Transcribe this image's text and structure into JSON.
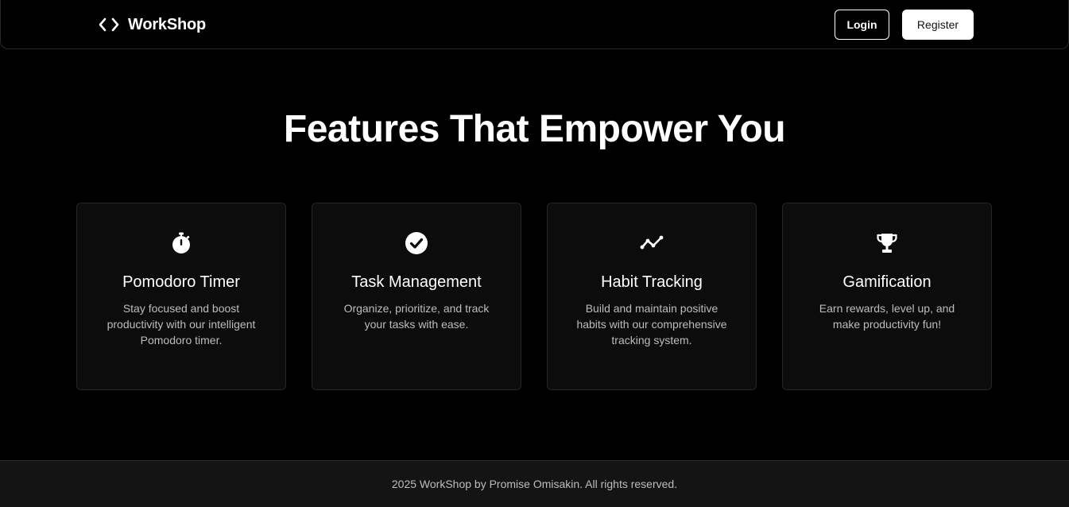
{
  "navbar": {
    "brand_name": "WorkShop",
    "brand_icon": "code-brackets-icon",
    "login_label": "Login",
    "register_label": "Register"
  },
  "hero": {
    "heading": "Features That Empower You"
  },
  "features": [
    {
      "icon": "stopwatch-icon",
      "title": "Pomodoro Timer",
      "description": "Stay focused and boost productivity with our intelligent Pomodoro timer."
    },
    {
      "icon": "check-circle-icon",
      "title": "Task Management",
      "description": "Organize, prioritize, and track your tasks with ease."
    },
    {
      "icon": "trend-line-icon",
      "title": "Habit Tracking",
      "description": "Build and maintain positive habits with our comprehensive tracking system."
    },
    {
      "icon": "trophy-icon",
      "title": "Gamification",
      "description": "Earn rewards, level up, and make productivity fun!"
    }
  ],
  "footer": {
    "text": "2025 WorkShop by Promise Omisakin. All rights reserved."
  },
  "colors": {
    "background": "#000000",
    "card_background": "#0c0c0c",
    "card_border": "#262626",
    "footer_background": "#141414",
    "muted_text": "#bdbdbd",
    "primary_text": "#ffffff"
  }
}
